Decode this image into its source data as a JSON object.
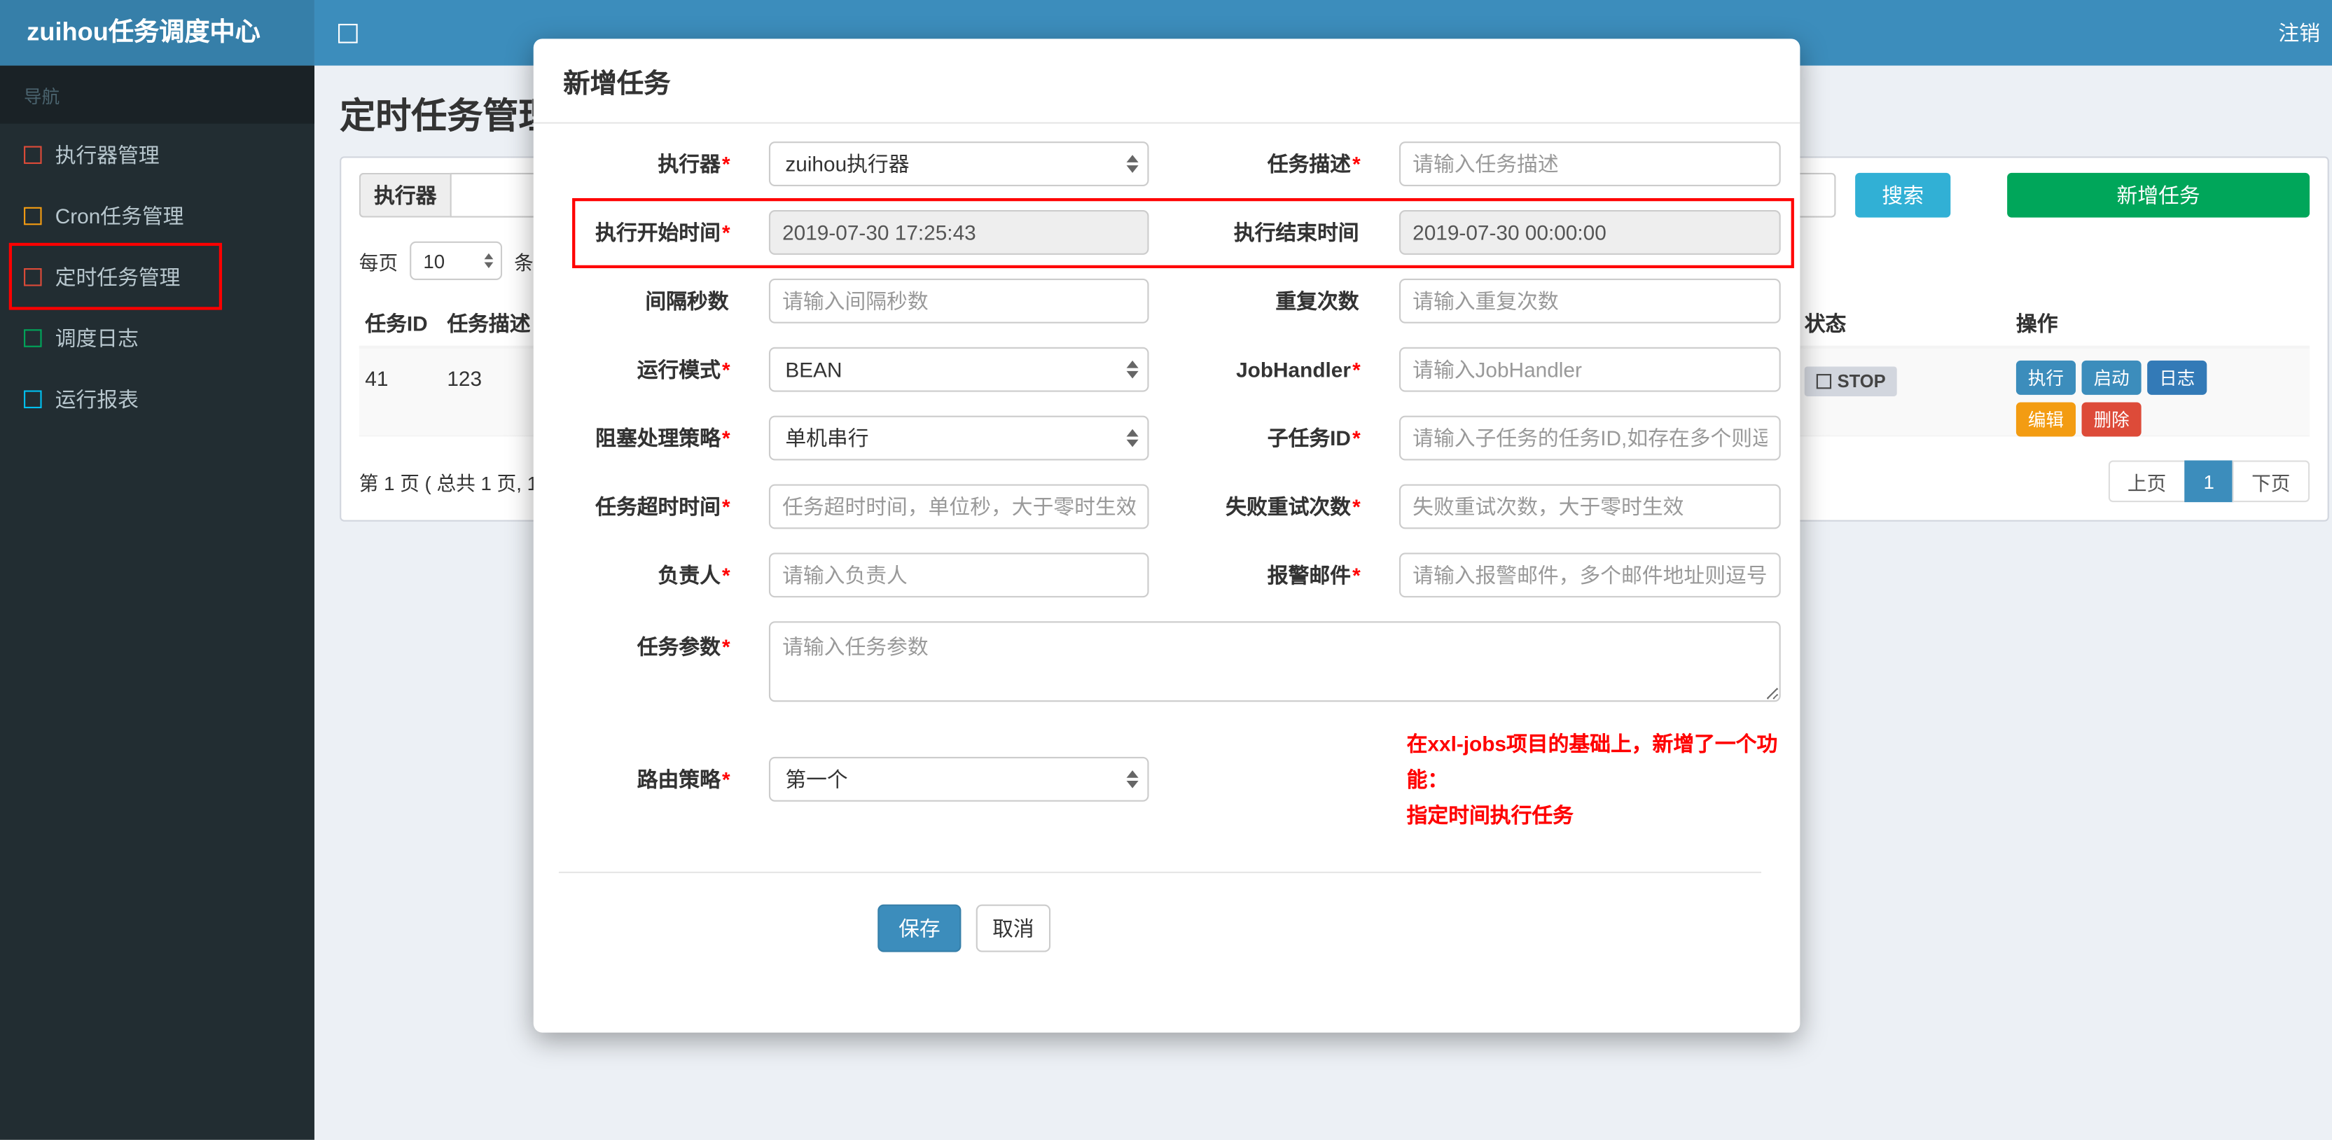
{
  "colors": {
    "navbar": "#3c8dbc",
    "brand_bg": "#367fa9",
    "sidebar_bg": "#222d32",
    "search_btn": "#31b0d5",
    "add_btn": "#00a65a",
    "save_btn": "#3c8dbc",
    "annotation": "#ff0000"
  },
  "icons": {
    "sidebar_toggle": "square-outline",
    "sidebar_item": "square-outline",
    "select_arrows": "up-down-triangles",
    "status_stop": "square-outline"
  },
  "header": {
    "brand": "zuihou任务调度中心",
    "logout": "注销"
  },
  "sidebar": {
    "section_label": "导航",
    "items": [
      {
        "label": "执行器管理",
        "icon_color": "#dd4b39"
      },
      {
        "label": "Cron任务管理",
        "icon_color": "#f39c12"
      },
      {
        "label": "定时任务管理",
        "icon_color": "#dd4b39"
      },
      {
        "label": "调度日志",
        "icon_color": "#00a65a"
      },
      {
        "label": "运行报表",
        "icon_color": "#00c0ef"
      }
    ]
  },
  "page": {
    "title": "定时任务管理",
    "filters": {
      "executor_label": "执行器",
      "search": "搜索",
      "add_task": "新增任务"
    },
    "per_page": {
      "prefix": "每页",
      "value": "10",
      "suffix": "条记"
    },
    "table": {
      "col_task_id": "任务ID",
      "col_task_desc": "任务描述",
      "col_status": "状态",
      "col_actions": "操作",
      "row": {
        "task_id": "41",
        "task_desc": "123",
        "status": "STOP",
        "actions": [
          {
            "label": "执行",
            "color": "#3c8dbc"
          },
          {
            "label": "启动",
            "color": "#3c8dbc"
          },
          {
            "label": "日志",
            "color": "#337ab7"
          },
          {
            "label": "编辑",
            "color": "#f39c12"
          },
          {
            "label": "删除",
            "color": "#dd4b39"
          }
        ]
      }
    },
    "pagination": {
      "summary": "第 1 页 ( 总共 1 页, 1",
      "prev": "上页",
      "page": "1",
      "next": "下页"
    }
  },
  "modal": {
    "title": "新增任务",
    "rows": [
      {
        "left": {
          "label": "执行器",
          "required": "*",
          "value": "zuihou执行器"
        },
        "right": {
          "label": "任务描述",
          "required": "*",
          "placeholder": "请输入任务描述"
        }
      },
      {
        "left": {
          "label": "执行开始时间",
          "required": "*",
          "value": "2019-07-30 17:25:43"
        },
        "right": {
          "label": "执行结束时间",
          "required": "",
          "value": "2019-07-30 00:00:00"
        }
      },
      {
        "left": {
          "label": "间隔秒数",
          "required": "",
          "placeholder": "请输入间隔秒数"
        },
        "right": {
          "label": "重复次数",
          "required": "",
          "placeholder": "请输入重复次数"
        }
      },
      {
        "left": {
          "label": "运行模式",
          "required": "*",
          "value": "BEAN"
        },
        "right": {
          "label": "JobHandler",
          "required": "*",
          "placeholder": "请输入JobHandler"
        }
      },
      {
        "left": {
          "label": "阻塞处理策略",
          "required": "*",
          "value": "单机串行"
        },
        "right": {
          "label": "子任务ID",
          "required": "*",
          "placeholder": "请输入子任务的任务ID,如存在多个则逗"
        }
      },
      {
        "left": {
          "label": "任务超时时间",
          "required": "*",
          "placeholder": "任务超时时间，单位秒，大于零时生效"
        },
        "right": {
          "label": "失败重试次数",
          "required": "*",
          "placeholder": "失败重试次数，大于零时生效"
        }
      },
      {
        "left": {
          "label": "负责人",
          "required": "*",
          "placeholder": "请输入负责人"
        },
        "right": {
          "label": "报警邮件",
          "required": "*",
          "placeholder": "请输入报警邮件，多个邮件地址则逗号分"
        }
      }
    ],
    "params": {
      "label": "任务参数",
      "required": "*",
      "placeholder": "请输入任务参数"
    },
    "route": {
      "label": "路由策略",
      "required": "*",
      "value": "第一个"
    },
    "note_line1": "在xxl-jobs项目的基础上，新增了一个功能：",
    "note_line2": "指定时间执行任务",
    "save": "保存",
    "cancel": "取消"
  }
}
